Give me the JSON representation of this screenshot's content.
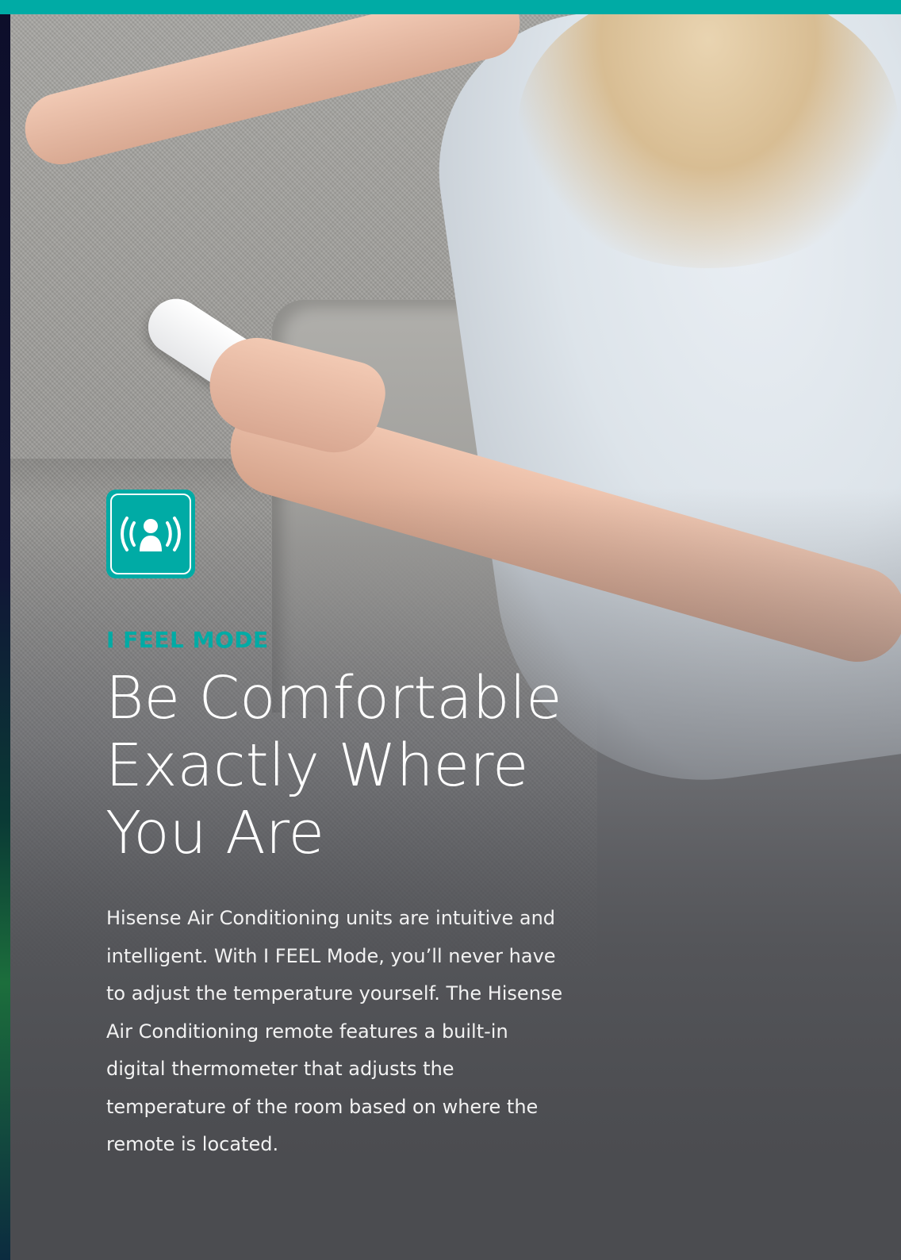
{
  "feature": {
    "icon": "i-feel-person-signal-icon",
    "eyebrow": "I FEEL MODE",
    "headline_lines": [
      "Be Comfortable",
      "Exactly Where",
      "You Are"
    ],
    "body": "Hisense Air Conditioning units are intuitive and intelligent. With I FEEL Mode, you’ll never have to adjust the temperature yourself. The Hisense Air Conditioning remote features a built-in digital thermometer that adjusts the temperature of the room based on where the remote is located."
  },
  "colors": {
    "accent": "#00aba5",
    "text": "#ffffff",
    "background": "#4b4c50"
  }
}
